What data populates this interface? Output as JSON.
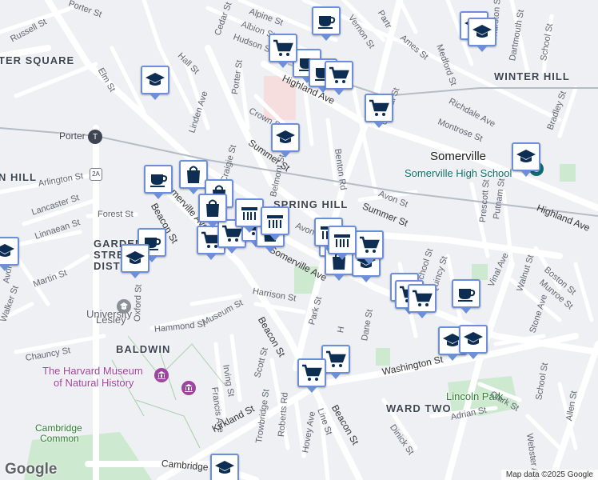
{
  "branding": {
    "logo": "Google",
    "attribution": "Map data ©2025 Google"
  },
  "neighborhoods": [
    {
      "id": "porter-square",
      "text": "TER SQUARE"
    },
    {
      "id": "winter-hill",
      "text": "WINTER HILL"
    },
    {
      "id": "spring-hill",
      "text": "SPRING HILL"
    },
    {
      "id": "ward-two",
      "text": "WARD TWO"
    },
    {
      "id": "baldwin",
      "text": "BALDWIN"
    },
    {
      "id": "hill-west",
      "text": "N HILL"
    },
    {
      "id": "garden-street",
      "text": "GARDEN"
    },
    {
      "id": "garden-street-2",
      "text": "STREET"
    },
    {
      "id": "garden-street-3",
      "text": "DIST"
    }
  ],
  "places": [
    {
      "id": "somerville",
      "text": "Somerville"
    },
    {
      "id": "somerville-high",
      "text": "Somerville High School"
    },
    {
      "id": "lesley",
      "text": "Lesley"
    },
    {
      "id": "lesley-2",
      "text": "University"
    },
    {
      "id": "harvard-museum",
      "text": "The Harvard Museum"
    },
    {
      "id": "harvard-museum-2",
      "text": "of Natural History"
    },
    {
      "id": "lincoln-park",
      "text": "Lincoln Park"
    },
    {
      "id": "cambridge-common",
      "text": "Cambridge"
    },
    {
      "id": "cambridge-common-2",
      "text": "Common"
    },
    {
      "id": "porter",
      "text": "Porter"
    }
  ],
  "streets": [
    {
      "id": "russell-st",
      "text": "Russell St"
    },
    {
      "id": "porter-st-top",
      "text": "Porter St"
    },
    {
      "id": "alpine-st",
      "text": "Alpine St"
    },
    {
      "id": "albion-st",
      "text": "Albion St"
    },
    {
      "id": "hudson-st",
      "text": "Hudson St"
    },
    {
      "id": "cedar-st",
      "text": "Cedar St"
    },
    {
      "id": "vernon-st",
      "text": "Vernon St"
    },
    {
      "id": "ames-st",
      "text": "Ames St"
    },
    {
      "id": "partridge",
      "text": "Partr"
    },
    {
      "id": "medford-st",
      "text": "Medford St"
    },
    {
      "id": "thurston-st",
      "text": "Thurston St"
    },
    {
      "id": "dartmouth-st",
      "text": "Dartmouth St"
    },
    {
      "id": "school-st-top",
      "text": "School St"
    },
    {
      "id": "elm-st",
      "text": "Elm St"
    },
    {
      "id": "hall-st",
      "text": "Hall St"
    },
    {
      "id": "highland-ave",
      "text": "Highland Ave"
    },
    {
      "id": "highland-ave-2",
      "text": "Highland Ave"
    },
    {
      "id": "richdale-ave",
      "text": "Richdale Ave"
    },
    {
      "id": "montrose-st",
      "text": "Montrose St"
    },
    {
      "id": "bradley-st",
      "text": "Bradley St"
    },
    {
      "id": "central-st",
      "text": "Central St"
    },
    {
      "id": "porter-st-mid",
      "text": "Porter St"
    },
    {
      "id": "linden-ave",
      "text": "Linden Ave"
    },
    {
      "id": "crown-st",
      "text": "Crown St"
    },
    {
      "id": "belmont-st",
      "text": "Belmont St"
    },
    {
      "id": "benton-rd",
      "text": "Benton Rd"
    },
    {
      "id": "summer-st",
      "text": "Summer St"
    },
    {
      "id": "summer-st-2",
      "text": "Summer St"
    },
    {
      "id": "craigie-st",
      "text": "Craigie St"
    },
    {
      "id": "arlington-st",
      "text": "Arlington St"
    },
    {
      "id": "lancaster-st",
      "text": "Lancaster St"
    },
    {
      "id": "forest-st",
      "text": "Forest St"
    },
    {
      "id": "linnaean-st",
      "text": "Linnaean St"
    },
    {
      "id": "somerville-ave",
      "text": "Somerville Ave"
    },
    {
      "id": "somerville-ave-2",
      "text": "Somerville Ave"
    },
    {
      "id": "beacon-st",
      "text": "Beacon St"
    },
    {
      "id": "beacon-st-2",
      "text": "Beacon St"
    },
    {
      "id": "beacon-st-3",
      "text": "Beacon St"
    },
    {
      "id": "avon-st",
      "text": "Avon St"
    },
    {
      "id": "avon-st-2",
      "text": "Avon St"
    },
    {
      "id": "prescott-st",
      "text": "Prescott St"
    },
    {
      "id": "putnam-st",
      "text": "Putnam St"
    },
    {
      "id": "vinal-ave",
      "text": "Vinal Ave"
    },
    {
      "id": "walnut-st",
      "text": "Walnut St"
    },
    {
      "id": "boston-st",
      "text": "Boston St"
    },
    {
      "id": "munroe-st",
      "text": "Munroe St"
    },
    {
      "id": "school-st",
      "text": "School St"
    },
    {
      "id": "quincy-st",
      "text": "Quincy St"
    },
    {
      "id": "park-st",
      "text": "Park St"
    },
    {
      "id": "harrison-st",
      "text": "Harrison St"
    },
    {
      "id": "martin-st",
      "text": "Martin St"
    },
    {
      "id": "avon-st-west",
      "text": "Avon St"
    },
    {
      "id": "walker-st",
      "text": "Walker St"
    },
    {
      "id": "oxford-st",
      "text": "Oxford St"
    },
    {
      "id": "hammond-st",
      "text": "Hammond St"
    },
    {
      "id": "museum-st",
      "text": "Museum St"
    },
    {
      "id": "chauncy-st",
      "text": "Chauncy St"
    },
    {
      "id": "irving-st",
      "text": "Irving St"
    },
    {
      "id": "francis-ave",
      "text": "Francis Ave"
    },
    {
      "id": "scott-st",
      "text": "Scott St"
    },
    {
      "id": "dane-st",
      "text": "Dane St"
    },
    {
      "id": "washington-st",
      "text": "Washington St"
    },
    {
      "id": "stone-ave",
      "text": "Stone Ave"
    },
    {
      "id": "kirkland-st",
      "text": "Kirkland St"
    },
    {
      "id": "trowbridge-st",
      "text": "Trowbridge St"
    },
    {
      "id": "roberts-rd",
      "text": "Roberts Rd"
    },
    {
      "id": "hovey-ave",
      "text": "Hovey Ave"
    },
    {
      "id": "line-st",
      "text": "Line St"
    },
    {
      "id": "dinick-st",
      "text": "Dinick St"
    },
    {
      "id": "clark-st",
      "text": "Clark St"
    },
    {
      "id": "adrian-st",
      "text": "Adrian St"
    },
    {
      "id": "webster-ave",
      "text": "Webster Ave"
    },
    {
      "id": "allen-st",
      "text": "Allen St"
    },
    {
      "id": "cambridge-st",
      "text": "Cambridge St"
    },
    {
      "id": "hunting",
      "text": "H"
    },
    {
      "id": "school-st-east",
      "text": "School St"
    }
  ],
  "shields": [
    {
      "id": "route-2a",
      "text": "2A"
    }
  ],
  "markers": [
    {
      "icon": "coffee-icon"
    },
    {
      "icon": "coffee-icon"
    },
    {
      "icon": "coffee-icon"
    },
    {
      "icon": "coffee-icon"
    },
    {
      "icon": "coffee-icon"
    },
    {
      "icon": "coffee-icon"
    },
    {
      "icon": "coffee-icon"
    },
    {
      "icon": "graduation-cap-icon"
    },
    {
      "icon": "graduation-cap-icon"
    },
    {
      "icon": "graduation-cap-icon"
    },
    {
      "icon": "graduation-cap-icon"
    },
    {
      "icon": "graduation-cap-icon"
    },
    {
      "icon": "graduation-cap-icon"
    },
    {
      "icon": "graduation-cap-icon"
    },
    {
      "icon": "graduation-cap-icon"
    },
    {
      "icon": "graduation-cap-icon"
    },
    {
      "icon": "graduation-cap-icon"
    },
    {
      "icon": "graduation-cap-icon"
    },
    {
      "icon": "shopping-cart-icon"
    },
    {
      "icon": "shopping-cart-icon"
    },
    {
      "icon": "shopping-cart-icon"
    },
    {
      "icon": "shopping-cart-icon"
    },
    {
      "icon": "shopping-cart-icon"
    },
    {
      "icon": "shopping-cart-icon"
    },
    {
      "icon": "shopping-cart-icon"
    },
    {
      "icon": "shopping-cart-icon"
    },
    {
      "icon": "shopping-cart-icon"
    },
    {
      "icon": "shopping-cart-icon"
    },
    {
      "icon": "shopping-cart-icon"
    },
    {
      "icon": "shopping-cart-icon"
    },
    {
      "icon": "shopping-bag-icon"
    },
    {
      "icon": "shopping-bag-icon"
    },
    {
      "icon": "shopping-bag-icon"
    },
    {
      "icon": "shopping-bag-icon"
    },
    {
      "icon": "shopping-bag-icon"
    },
    {
      "icon": "storefront-icon"
    },
    {
      "icon": "storefront-icon"
    },
    {
      "icon": "storefront-icon"
    },
    {
      "icon": "storefront-icon"
    }
  ],
  "colors": {
    "marker_border": "#6d8fd9",
    "marker_icon": "#0d2d52",
    "poi_purple": "#a142a1",
    "park_green": "#cde9cf",
    "teal_place": "#0e6d6d",
    "water_label": "#3a7a3a"
  }
}
